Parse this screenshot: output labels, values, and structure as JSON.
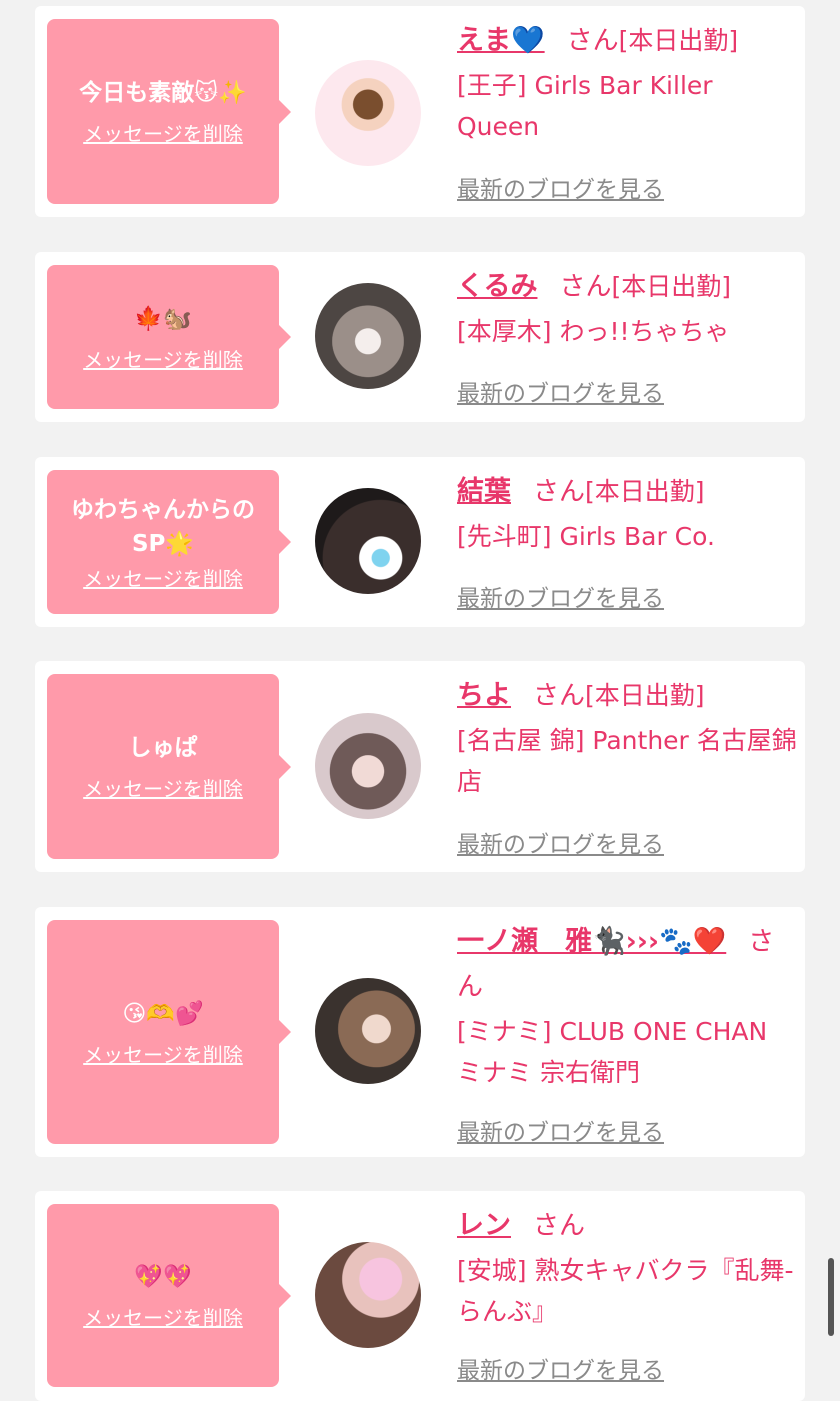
{
  "items": [
    {
      "message": "今日も素敵😽✨",
      "delete_label": "メッセージを削除",
      "name": "えま💙",
      "san": "さん",
      "status": "[本日出勤]",
      "shop": "[王子] Girls Bar Killer Queen",
      "blog_link": "最新のブログを見る"
    },
    {
      "message": "🍁🐿️",
      "delete_label": "メッセージを削除",
      "name": "くるみ",
      "san": "さん",
      "status": "[本日出勤]",
      "shop": "[本厚木] わっ!!ちゃちゃ",
      "blog_link": "最新のブログを見る"
    },
    {
      "message": "ゆわちゃんからのSP🌟",
      "delete_label": "メッセージを削除",
      "name": "結葉",
      "san": "さん",
      "status": "[本日出勤]",
      "shop": "[先斗町] Girls Bar Co.",
      "blog_link": "最新のブログを見る"
    },
    {
      "message": "しゅぱ",
      "delete_label": "メッセージを削除",
      "name": "ちよ",
      "san": "さん",
      "status": "[本日出勤]",
      "shop": "[名古屋 錦] Panther 名古屋錦店",
      "blog_link": "最新のブログを見る"
    },
    {
      "message": "😘🫶💕",
      "delete_label": "メッセージを削除",
      "name": "一ノ瀬　雅🐈‍⬛›››🐾❤️",
      "san": "さん",
      "status": "",
      "shop": "[ミナミ] CLUB ONE CHAN ミナミ 宗右衛門",
      "blog_link": "最新のブログを見る"
    },
    {
      "message": "💖💖",
      "delete_label": "メッセージを削除",
      "name": "レン",
      "san": "さん",
      "status": "",
      "shop": "[安城] 熟女キャバクラ『乱舞-らんぶ』",
      "blog_link": "最新のブログを見る"
    }
  ],
  "colors": {
    "accent": "#e8376a",
    "bubble": "#ff9aaa",
    "link_gray": "#8a8a8a"
  }
}
